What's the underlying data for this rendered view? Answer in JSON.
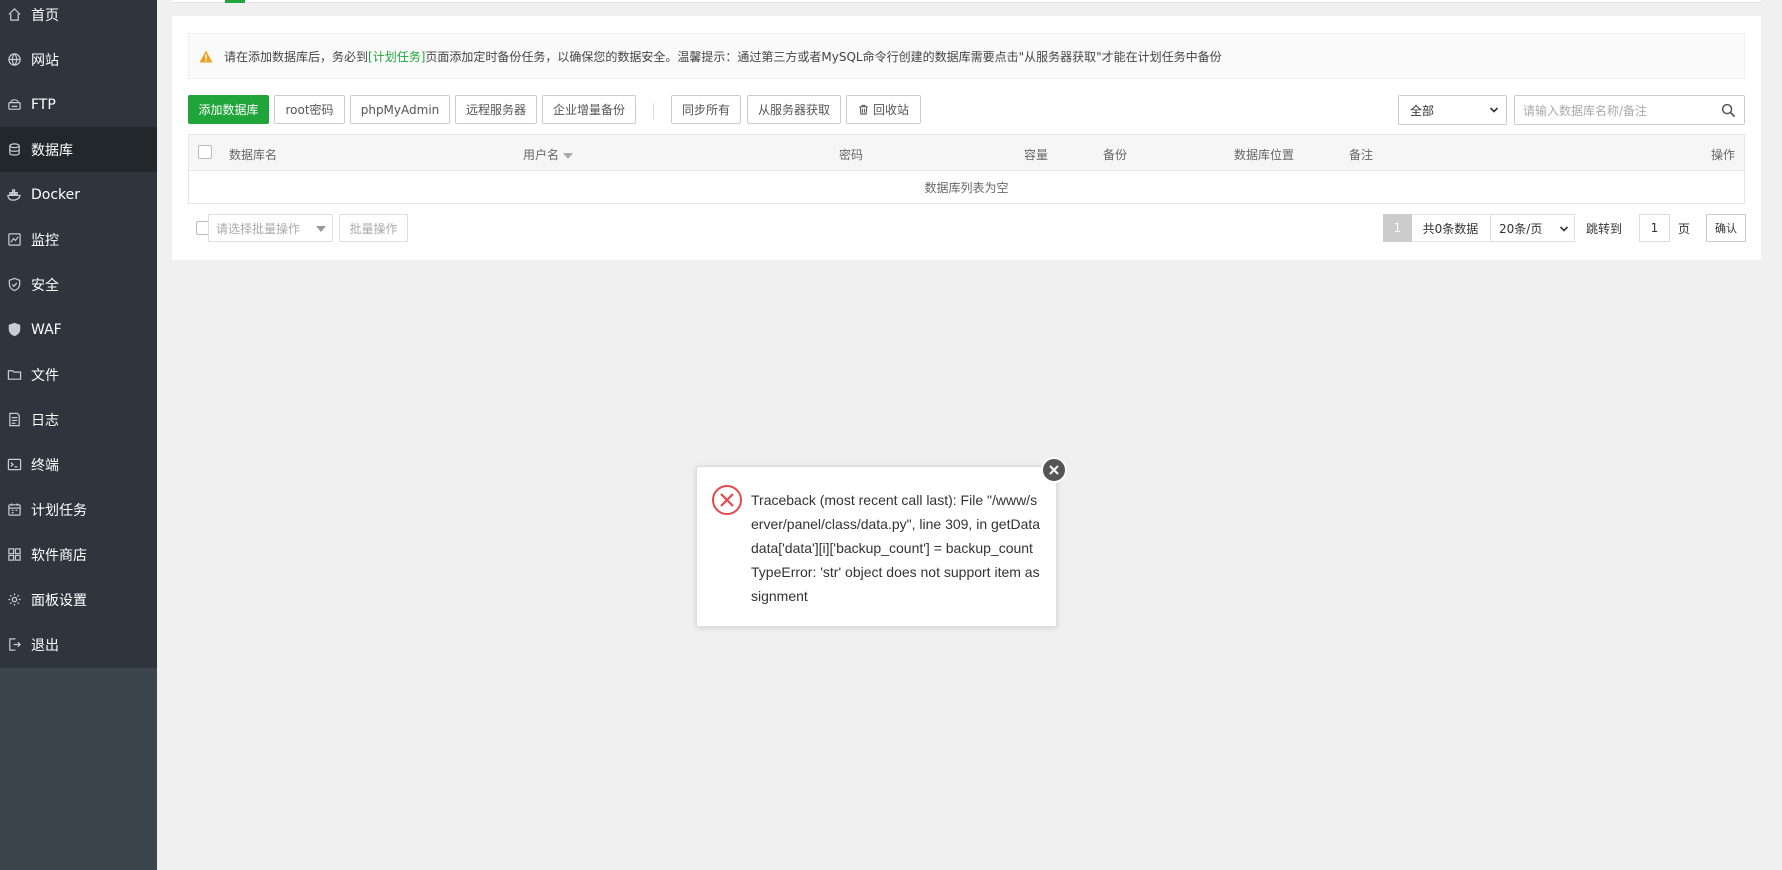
{
  "sidebar": {
    "items": [
      {
        "label": "首页",
        "icon": "home-icon"
      },
      {
        "label": "网站",
        "icon": "globe-icon"
      },
      {
        "label": "FTP",
        "icon": "ftp-icon"
      },
      {
        "label": "数据库",
        "icon": "database-icon",
        "active": true
      },
      {
        "label": "Docker",
        "icon": "docker-icon"
      },
      {
        "label": "监控",
        "icon": "monitor-icon"
      },
      {
        "label": "安全",
        "icon": "shield-icon"
      },
      {
        "label": "WAF",
        "icon": "waf-icon"
      },
      {
        "label": "文件",
        "icon": "folder-icon"
      },
      {
        "label": "日志",
        "icon": "log-icon"
      },
      {
        "label": "终端",
        "icon": "terminal-icon"
      },
      {
        "label": "计划任务",
        "icon": "calendar-icon"
      },
      {
        "label": "软件商店",
        "icon": "apps-icon"
      },
      {
        "label": "面板设置",
        "icon": "gear-icon"
      },
      {
        "label": "退出",
        "icon": "logout-icon"
      }
    ]
  },
  "notice": {
    "before": "请在添加数据库后，务必到",
    "link": "[计划任务]",
    "after": "页面添加定时备份任务，以确保您的数据安全。温馨提示：通过第三方或者MySQL命令行创建的数据库需要点击\"从服务器获取\"才能在计划任务中备份"
  },
  "toolbar": {
    "add_db": "添加数据库",
    "root_pwd": "root密码",
    "phpmyadmin": "phpMyAdmin",
    "remote_server": "远程服务器",
    "enterprise_backup": "企业增量备份",
    "sync_all": "同步所有",
    "fetch_from_server": "从服务器获取",
    "recycle_bin": "回收站"
  },
  "filter": {
    "selected": "全部",
    "search_placeholder": "请输入数据库名称/备注"
  },
  "table": {
    "columns": {
      "name": "数据库名",
      "user": "用户名",
      "password": "密码",
      "capacity": "容量",
      "backup": "备份",
      "location": "数据库位置",
      "note": "备注",
      "actions": "操作"
    },
    "empty_text": "数据库列表为空"
  },
  "batch": {
    "select_placeholder": "请选择批量操作",
    "button": "批量操作"
  },
  "pagination": {
    "current_page": "1",
    "total": "共0条数据",
    "page_size": "20条/页",
    "jump_label": "跳转到",
    "jump_value": "1",
    "unit": "页",
    "confirm": "确认"
  },
  "error_dialog": {
    "message": "Traceback (most recent call last): File \"/www/server/panel/class/data.py\", line 309, in getData data['data'][i]['backup_count'] = backup_count TypeError: 'str' object does not support item assignment"
  },
  "colors": {
    "accent": "#20a53a",
    "sidebar_bg": "#2f353c",
    "sidebar_active": "#22272c",
    "error": "#e5484d",
    "warning": "#f0a020"
  }
}
